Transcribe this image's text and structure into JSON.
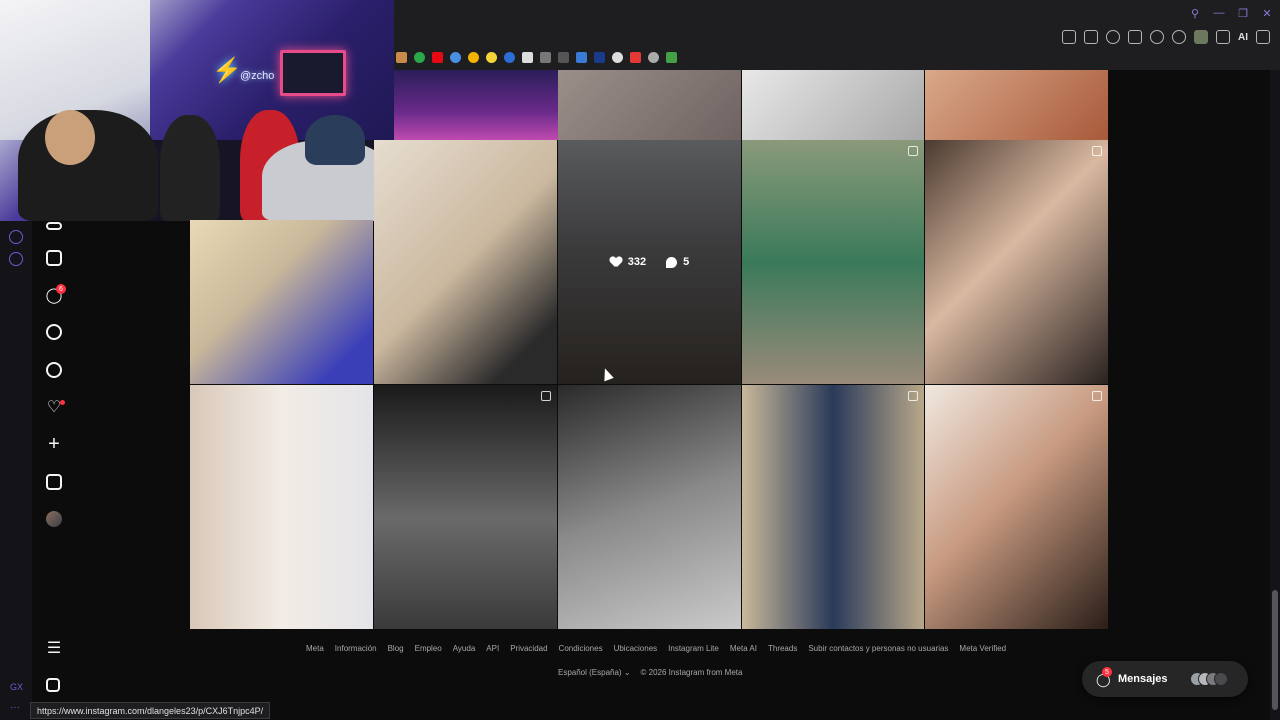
{
  "browser": {
    "ai_label": "AI",
    "status_url": "https://www.instagram.com/dlangeles23/p/CXJ6Tnjpc4P/",
    "rail_text": "GX",
    "rail_dots": "···"
  },
  "webcam": {
    "neon_sign": "@zcho"
  },
  "sidebar": {
    "notifications_badge": "6"
  },
  "post_hover": {
    "likes": "332",
    "comments": "5"
  },
  "footer": {
    "links": [
      "Meta",
      "Información",
      "Blog",
      "Empleo",
      "Ayuda",
      "API",
      "Privacidad",
      "Condiciones",
      "Ubicaciones",
      "Instagram Lite",
      "Meta AI",
      "Threads",
      "Subir contactos y personas no usuarias",
      "Meta Verified"
    ],
    "language": "Español (España)",
    "copyright": "© 2026 Instagram from Meta"
  },
  "messages": {
    "label": "Mensajes",
    "badge": "5"
  },
  "colors": {
    "background": "#0c0c0c",
    "chrome": "#1e1e21",
    "accent_purple": "#6d5bd0",
    "notification_red": "#ff3040"
  }
}
